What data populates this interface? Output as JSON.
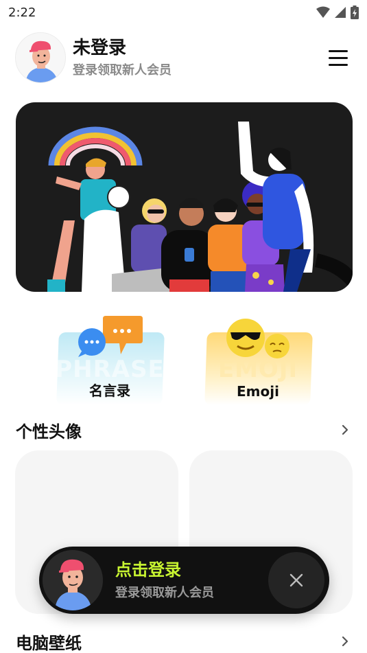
{
  "status_bar": {
    "time": "2:22"
  },
  "header": {
    "user_name": "未登录",
    "user_subtitle": "登录领取新人会员"
  },
  "categories": [
    {
      "label": "名言录",
      "watermark": "PHRASE",
      "icon": "chat-bubbles-icon"
    },
    {
      "label": "Emoji",
      "watermark": "EMOJI",
      "icon": "emoji-faces-icon"
    }
  ],
  "sections": {
    "avatars": {
      "title": "个性头像"
    },
    "wallpapers": {
      "title": "电脑壁纸"
    }
  },
  "login_toast": {
    "title": "点击登录",
    "subtitle": "登录领取新人会员"
  },
  "colors": {
    "accent": "#c8f531",
    "toast_bg": "#111111",
    "banner_bg": "#1c1c1c"
  }
}
